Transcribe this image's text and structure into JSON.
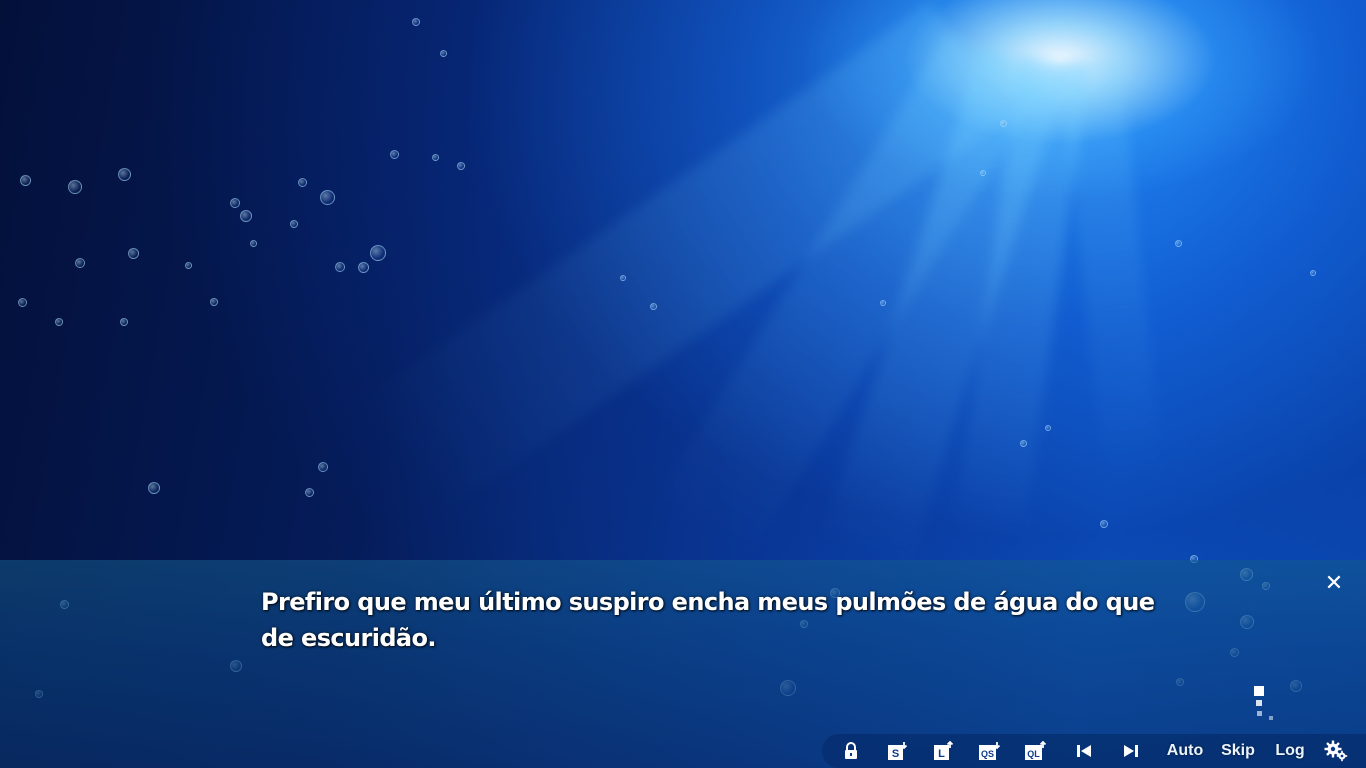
{
  "dialogue": {
    "text": "Prefiro que meu último suspiro encha meus pulmões de água do que de escuridão."
  },
  "close_button": {
    "label": "✕"
  },
  "quick_menu": {
    "items": [
      {
        "name": "lock",
        "icon": "lock-icon",
        "label": ""
      },
      {
        "name": "save",
        "icon": "save-icon",
        "label": "S"
      },
      {
        "name": "load",
        "icon": "load-icon",
        "label": "L"
      },
      {
        "name": "quick-save",
        "icon": "quick-save-icon",
        "label": "QS"
      },
      {
        "name": "quick-load",
        "icon": "quick-load-icon",
        "label": "QL"
      },
      {
        "name": "rewind",
        "icon": "skip-back-icon",
        "label": ""
      },
      {
        "name": "forward",
        "icon": "skip-forward-icon",
        "label": ""
      },
      {
        "name": "auto",
        "icon": "",
        "label": "Auto"
      },
      {
        "name": "skip",
        "icon": "",
        "label": "Skip"
      },
      {
        "name": "log",
        "icon": "",
        "label": "Log"
      },
      {
        "name": "settings",
        "icon": "gear-icon",
        "label": ""
      }
    ]
  },
  "colors": {
    "menu_bar": "#062d6e",
    "text": "#ffffff"
  }
}
